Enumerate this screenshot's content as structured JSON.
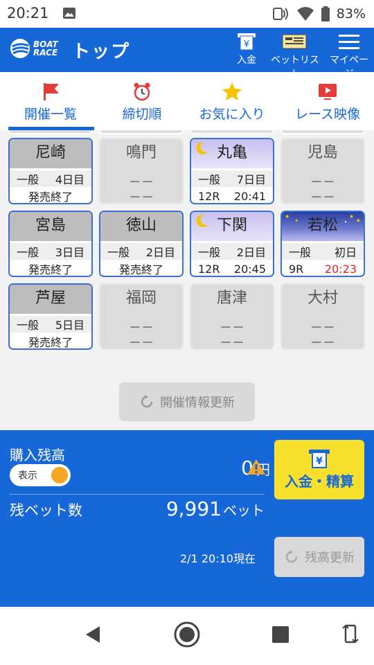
{
  "status": {
    "time": "20:21",
    "battery": "83%"
  },
  "header": {
    "title": "トップ",
    "logo_line1": "BOAT",
    "logo_line2": "RACE",
    "deposit": "入金",
    "betlist": "ベットリスト",
    "mypage": "マイページ"
  },
  "tabs": [
    {
      "label": "開催一覧",
      "icon": "flag-icon",
      "selected": true
    },
    {
      "label": "締切順",
      "icon": "alarm-clock-icon"
    },
    {
      "label": "お気に入り",
      "icon": "star-icon"
    },
    {
      "label": "レース映像",
      "icon": "video-play-icon"
    }
  ],
  "venues": [
    {
      "name": "尼崎",
      "grade": "一般",
      "day": "4日目",
      "status": "発売終了"
    },
    {
      "name": "鳴門",
      "line1": "－－",
      "line2": "－－"
    },
    {
      "name": "丸亀",
      "grade": "一般",
      "day": "7日目",
      "race": "12R",
      "time": "20:41"
    },
    {
      "name": "児島",
      "line1": "－－",
      "line2": "－－"
    },
    {
      "name": "宮島",
      "grade": "一般",
      "day": "3日目",
      "status": "発売終了"
    },
    {
      "name": "徳山",
      "grade": "一般",
      "day": "2日目",
      "status": "発売終了"
    },
    {
      "name": "下関",
      "grade": "一般",
      "day": "2日目",
      "race": "12R",
      "time": "20:45"
    },
    {
      "name": "若松",
      "grade": "一般",
      "day": "初日",
      "race": "9R",
      "time": "20:23"
    },
    {
      "name": "芦屋",
      "grade": "一般",
      "day": "5日目",
      "status": "発売終了"
    },
    {
      "name": "福岡",
      "line1": "－－",
      "line2": "－－"
    },
    {
      "name": "唐津",
      "line1": "－－",
      "line2": "－－"
    },
    {
      "name": "大村",
      "line1": "－－",
      "line2": "－－"
    }
  ],
  "refresh_info": "開催情報更新",
  "balance": {
    "label": "購入残高",
    "toggle": "表示",
    "amount": "0",
    "amount_unit": "円",
    "deposit_button": "入金・精算",
    "bets_label": "残ベット数",
    "bets": "9,991",
    "bets_unit": "ベット",
    "as_of": "2/1 20:10現在",
    "refresh": "残高更新"
  },
  "colors": {
    "primary": "#1667d8",
    "accent": "#f7e12c",
    "warning": "#f5a623",
    "deadline": "#e52222"
  }
}
